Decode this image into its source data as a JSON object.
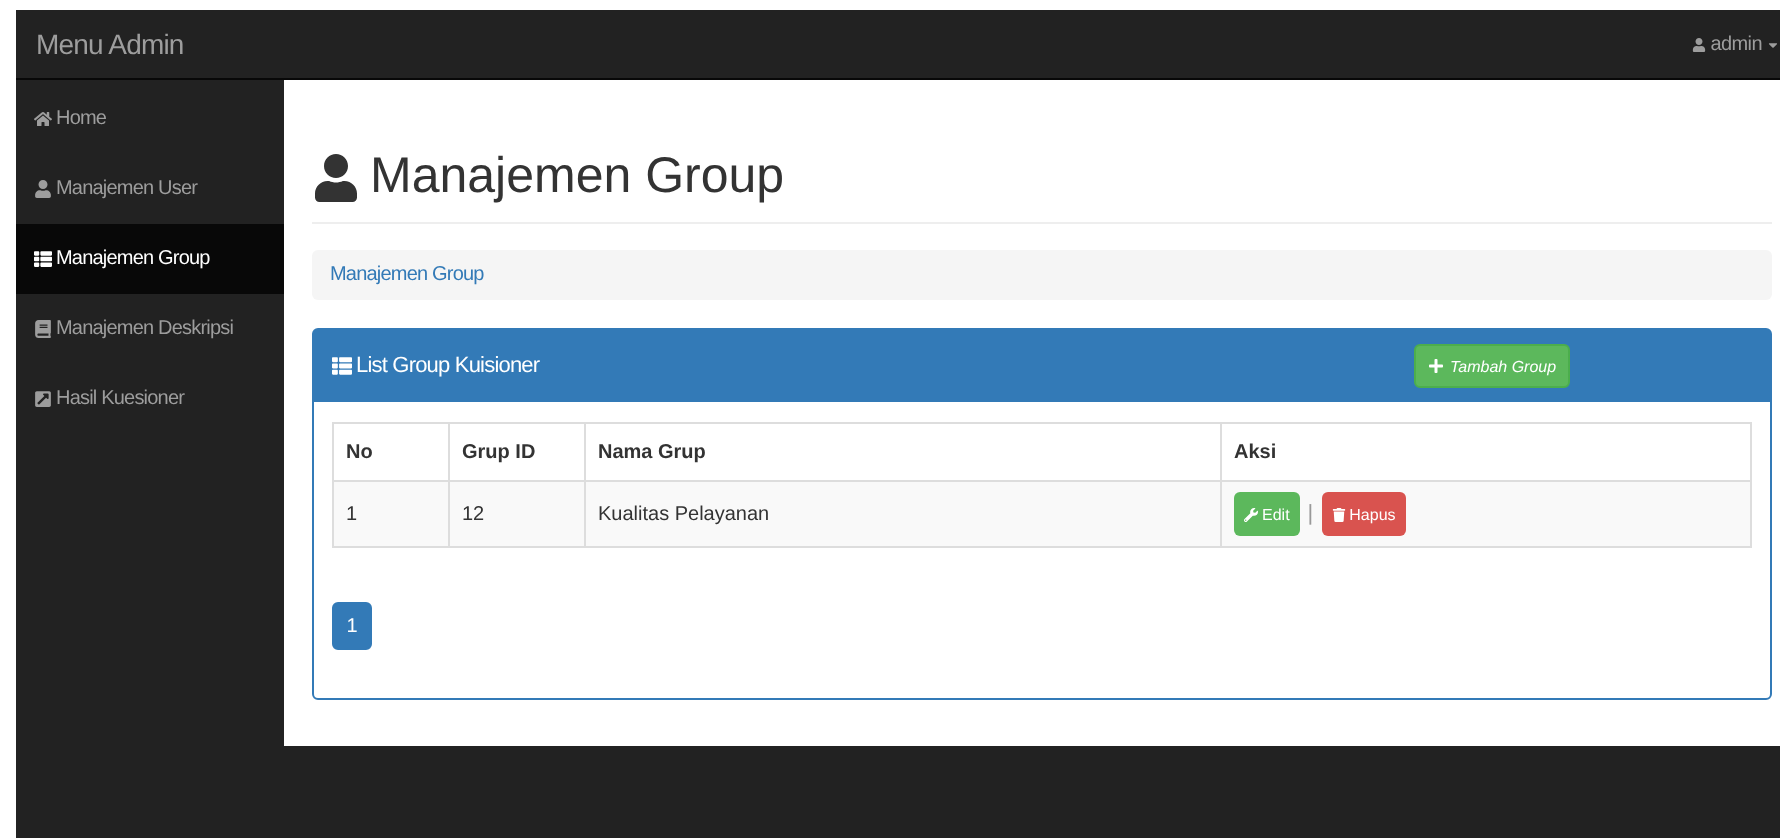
{
  "navbar": {
    "brand": "Menu Admin",
    "user": "admin"
  },
  "sidebar": {
    "items": [
      {
        "label": "Home",
        "selected": false
      },
      {
        "label": "Manajemen User",
        "selected": false
      },
      {
        "label": "Manajemen Group",
        "selected": true
      },
      {
        "label": "Manajemen Deskripsi",
        "selected": false
      },
      {
        "label": "Hasil Kuesioner",
        "selected": false
      }
    ]
  },
  "page": {
    "title": "Manajemen Group",
    "breadcrumb": "Manajemen Group"
  },
  "panel": {
    "title": "List Group Kuisioner",
    "add_button": "Tambah Group",
    "table": {
      "columns": [
        "No",
        "Grup ID",
        "Nama Grup",
        "Aksi"
      ],
      "rows": [
        {
          "no": "1",
          "grup_id": "12",
          "nama_grup": "Kualitas Pelayanan",
          "edit": "Edit",
          "separator": "|",
          "delete": "Hapus"
        }
      ]
    },
    "pagination": [
      {
        "label": "1",
        "selected": true
      }
    ]
  }
}
